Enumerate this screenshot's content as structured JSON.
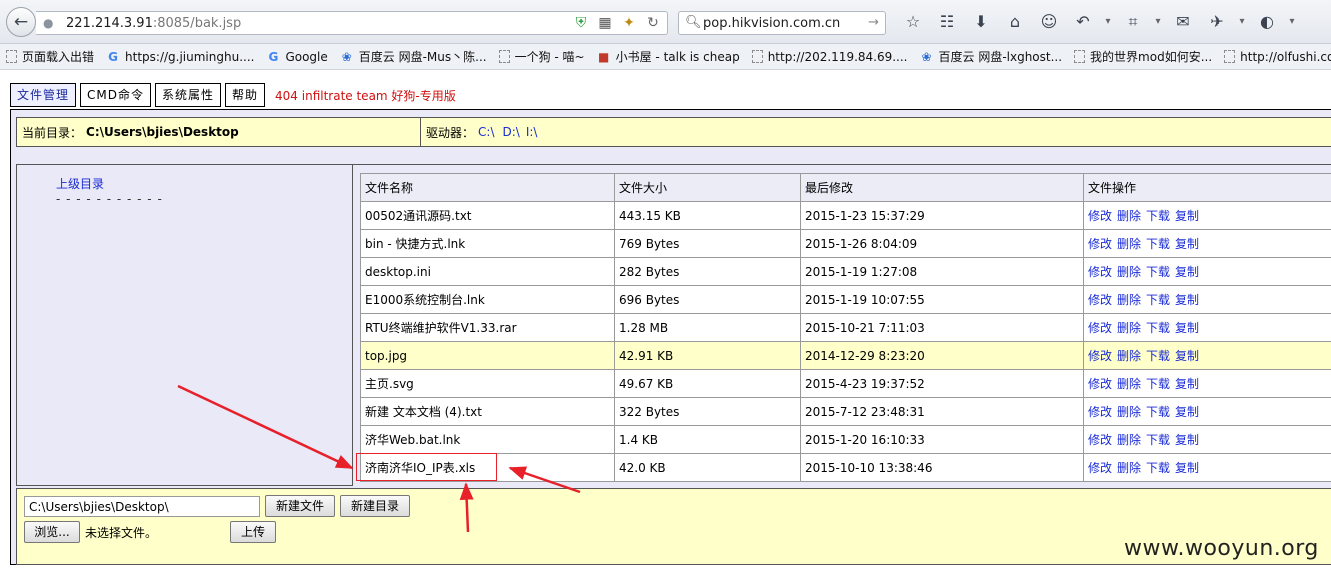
{
  "browser": {
    "back_icon": "back-arrow-icon",
    "url_host": "221.214.3.91",
    "url_port_path": ":8085/bak.jsp",
    "search_text": "pop.hikvision.com.cn",
    "search_go": "→"
  },
  "bookmarks": [
    {
      "label": "页面载入出错",
      "icon": "page"
    },
    {
      "label": "https://g.jiuminghu....",
      "icon": "google"
    },
    {
      "label": "Google",
      "icon": "google"
    },
    {
      "label": "百度云 网盘-Mus丶陈...",
      "icon": "baidu"
    },
    {
      "label": "一个狗 - 喵~",
      "icon": "page"
    },
    {
      "label": "小书屋 - talk is cheap",
      "icon": "book"
    },
    {
      "label": "http://202.119.84.69....",
      "icon": "page"
    },
    {
      "label": "百度云 网盘-lxghost...",
      "icon": "baidu"
    },
    {
      "label": "我的世界mod如何安...",
      "icon": "page"
    },
    {
      "label": "http://olfushi.com/",
      "icon": "page"
    }
  ],
  "nav": {
    "file_manage": "文件管理",
    "cmd": "CMD命令",
    "sys_props": "系统属性",
    "help": "帮助",
    "team": "404 infiltrate team 好狗-专用版"
  },
  "dir": {
    "current_label": "当前目录：",
    "current_path": "C:\\Users\\bjies\\Desktop",
    "drive_label": "驱动器：",
    "drives": [
      "C:\\",
      "D:\\",
      "I:\\"
    ]
  },
  "left": {
    "up": "上级目录",
    "dashes": "- - - - - - - - - - -"
  },
  "table": {
    "headers": [
      "文件名称",
      "文件大小",
      "最后修改",
      "文件操作"
    ],
    "ops": [
      "修改",
      "删除",
      "下载",
      "复制"
    ],
    "rows": [
      {
        "name": "00502通讯源码.txt",
        "size": "443.15 KB",
        "modified": "2015-1-23 15:37:29"
      },
      {
        "name": "bin - 快捷方式.lnk",
        "size": "769 Bytes",
        "modified": "2015-1-26 8:04:09"
      },
      {
        "name": "desktop.ini",
        "size": "282 Bytes",
        "modified": "2015-1-19 1:27:08"
      },
      {
        "name": "E1000系统控制台.lnk",
        "size": "696 Bytes",
        "modified": "2015-1-19 10:07:55"
      },
      {
        "name": "RTU终端维护软件V1.33.rar",
        "size": "1.28 MB",
        "modified": "2015-10-21 7:11:03"
      },
      {
        "name": "top.jpg",
        "size": "42.91 KB",
        "modified": "2014-12-29 8:23:20"
      },
      {
        "name": "主页.svg",
        "size": "49.67 KB",
        "modified": "2015-4-23 19:37:52"
      },
      {
        "name": "新建 文本文档 (4).txt",
        "size": "322 Bytes",
        "modified": "2015-7-12 23:48:31"
      },
      {
        "name": "济华Web.bat.lnk",
        "size": "1.4 KB",
        "modified": "2015-1-20 16:10:33"
      },
      {
        "name": "济南济华IO_IP表.xls",
        "size": "42.0 KB",
        "modified": "2015-10-10 13:38:46"
      }
    ]
  },
  "bottom": {
    "path_value": "C:\\Users\\bjies\\Desktop\\",
    "new_file": "新建文件",
    "new_dir": "新建目录",
    "browse": "浏览...",
    "no_file": "未选择文件。",
    "upload": "上传"
  },
  "watermark": "www.wooyun.org",
  "colors": {
    "link": "#1a2bd6",
    "team": "#d01010",
    "highlight_row": "#ffffc9",
    "annotation": "#e8202a"
  }
}
